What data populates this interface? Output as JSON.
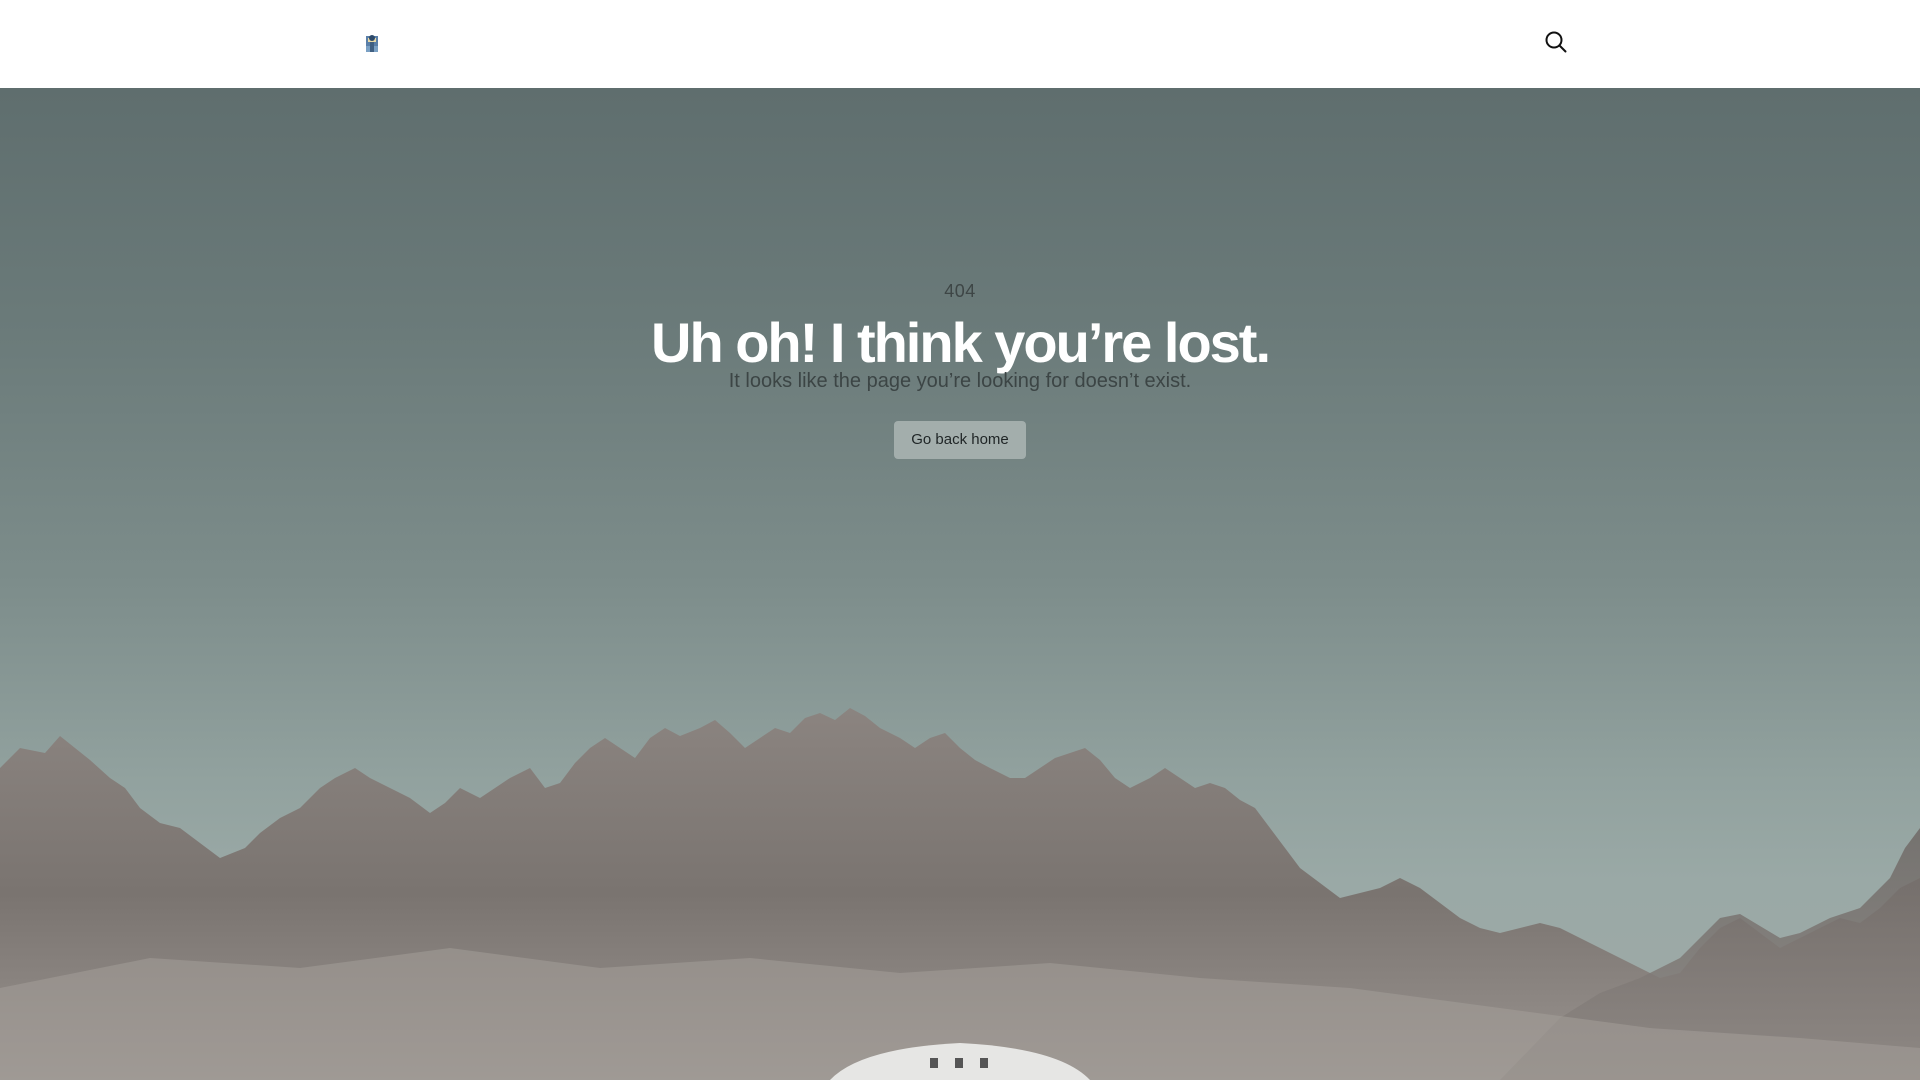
{
  "header": {
    "logo_icon": "site-logo-icon",
    "search_icon": "search-icon"
  },
  "error": {
    "code": "404",
    "headline": "Uh oh! I think you’re lost.",
    "message": "It looks like the page you’re looking for doesn’t exist.",
    "home_button_label": "Go back home"
  },
  "colors": {
    "header_bg": "#ffffff",
    "sky_top": "#5f6e6e",
    "sky_bottom": "#9fa9a6",
    "headline": "#ffffff",
    "button_bg": "#a3aeac",
    "mountains": "#7d7672"
  }
}
